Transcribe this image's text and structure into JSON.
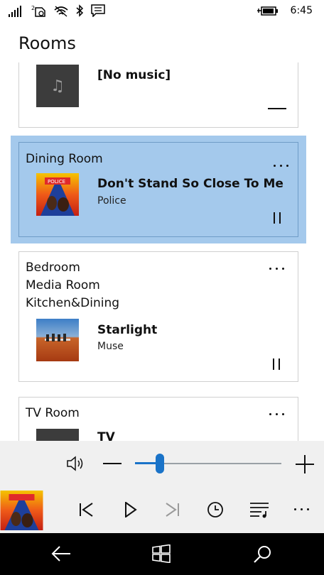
{
  "status_bar": {
    "time": "6:45",
    "icons": [
      "signal-icon",
      "sim2-icon",
      "wifi-icon",
      "bluetooth-icon",
      "message-icon",
      "battery-charging-icon"
    ]
  },
  "page": {
    "title": "Rooms"
  },
  "rooms": [
    {
      "names": [],
      "track": "[No music]",
      "artist": "",
      "art": "music-note-icon",
      "control": "stop"
    },
    {
      "names": [
        "Dining Room"
      ],
      "track": "Don't Stand So Close To Me",
      "artist": "Police",
      "art": "album-art-zenyatta",
      "control": "pause",
      "selected": true
    },
    {
      "names": [
        "Bedroom",
        "Media Room",
        "Kitchen&Dining"
      ],
      "track": "Starlight",
      "artist": "Muse",
      "art": "album-art-black-holes",
      "control": "pause"
    },
    {
      "names": [
        "TV Room"
      ],
      "track": "TV",
      "artist": "",
      "art": "tv-input-art",
      "control": ""
    }
  ],
  "volume": {
    "level": 0.17
  },
  "colors": {
    "accent": "#1a73c8",
    "selection": "#a4c9ec",
    "navbar": "#000000"
  }
}
